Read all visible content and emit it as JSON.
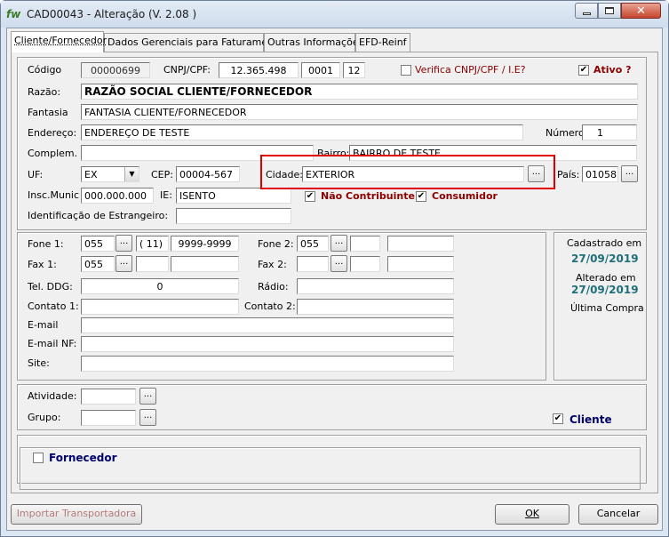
{
  "window": {
    "title": "CAD00043 - Alteração  (V.  2.08 )",
    "icon_text": "fw"
  },
  "tabs": [
    {
      "label": "Cliente/Fornecedor",
      "active": true
    },
    {
      "label": "Dados Gerenciais para Faturamento"
    },
    {
      "label": "Outras Informações"
    },
    {
      "label": "EFD-Reinf"
    }
  ],
  "form": {
    "codigo_label": "Código",
    "codigo_value": "00000699",
    "cnpj_label": "CNPJ/CPF:",
    "cnpj_part1": "12.365.498",
    "cnpj_part2": "0001",
    "cnpj_part3": "12",
    "verifica_label": "Verifica CNPJ/CPF / I.E?",
    "ativo_label": "Ativo ?",
    "ativo_checked": "✔",
    "razao_label": "Razão:",
    "razao_value": "RAZÃO SOCIAL CLIENTE/FORNECEDOR",
    "fantasia_label": "Fantasia",
    "fantasia_value": "FANTASIA CLIENTE/FORNECEDOR",
    "endereco_label": "Endereço:",
    "endereco_value": "ENDEREÇO DE TESTE",
    "numero_label": "Número:",
    "numero_value": "1",
    "complem_label": "Complem.",
    "complem_value": "",
    "bairro_label": "Bairro:",
    "bairro_value": "BAIRRO DE TESTE",
    "uf_label": "UF:",
    "uf_value": "EX",
    "cep_label": "CEP:",
    "cep_value": "00004-567",
    "cidade_label": "Cidade:",
    "cidade_value": "EXTERIOR",
    "pais_label": "País:",
    "pais_value": "01058",
    "inscmunic_label": "Insc.Munic",
    "inscmunic_value": "000.000.000",
    "ie_label": "IE:",
    "ie_value": "ISENTO",
    "nao_contribuinte_label": "Não Contribuinte",
    "consumidor_label": "Consumidor",
    "id_estrangeiro_label": "Identificação de Estrangeiro:",
    "id_estrangeiro_value": ""
  },
  "contact": {
    "fone1_label": "Fone 1:",
    "fone1_country": "055",
    "fone1_area": "( 11)",
    "fone1_number": "9999-9999",
    "fone2_label": "Fone 2:",
    "fone2_country": "055",
    "fax1_label": "Fax 1:",
    "fax1_country": "055",
    "fax2_label": "Fax 2:",
    "teldgg_label": "Tel. DDG:",
    "teldgg_value": "0",
    "radio_label": "Rádio:",
    "contato1_label": "Contato 1:",
    "contato2_label": "Contato 2:",
    "email_label": "E-mail",
    "emailnf_label": "E-mail NF:",
    "site_label": "Site:"
  },
  "info": {
    "cadastrado_label": "Cadastrado em",
    "cadastrado_value": "27/09/2019",
    "alterado_label": "Alterado em",
    "alterado_value": "27/09/2019",
    "ultima_compra_label": "Última Compra"
  },
  "classification": {
    "atividade_label": "Atividade:",
    "grupo_label": "Grupo:",
    "cliente_label": "Cliente",
    "fornecedor_label": "Fornecedor"
  },
  "buttons": {
    "ellipsis": "...",
    "importar": "Importar Transportadora",
    "ok": "OK",
    "cancelar": "Cancelar"
  },
  "colors": {
    "accent_red": "#8b0000",
    "accent_navy": "#00006e",
    "accent_teal": "#1f6f7a",
    "highlight": "#e00000"
  }
}
